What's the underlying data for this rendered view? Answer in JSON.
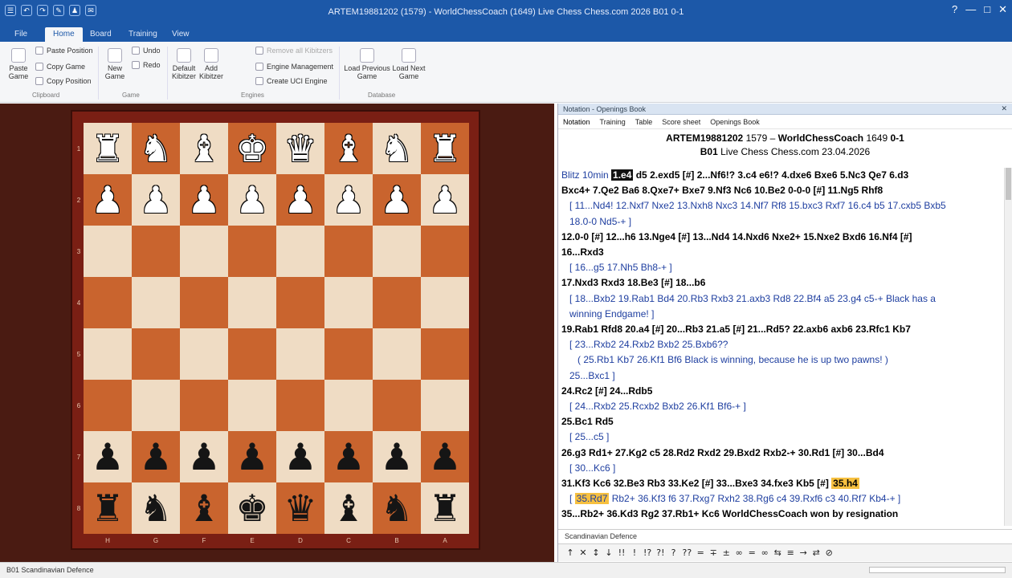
{
  "window": {
    "title": "ARTEM19881202 (1579) - WorldChessCoach (1649)  Live Chess Chess.com 2026  B01 0-1",
    "controls": [
      "?",
      "—",
      "□",
      "✕"
    ]
  },
  "quick_access": [
    "☰",
    "↶",
    "↷",
    "✎",
    "♟",
    "✉"
  ],
  "menu_tabs": [
    "File",
    "Home",
    "Board",
    "Training",
    "View"
  ],
  "ribbon": {
    "paste_game": "Paste Game",
    "paste_position": "Paste Position",
    "copy_game": "Copy Game",
    "copy_position": "Copy Position",
    "new_game": "New Game",
    "undo": "Undo",
    "redo": "Redo",
    "default_kibitzer": "Default Kibitzer",
    "add_kibitzer": "Add Kibitzer",
    "remove_kibitzer": "Remove all Kibitzers",
    "engine_management": "Engine Management",
    "create_uci": "Create UCI Engine",
    "load_previous": "Load Previous Game",
    "load_next": "Load Next Game",
    "groups": [
      "Clipboard",
      "Game",
      "Engines",
      "Database"
    ]
  },
  "board": {
    "ranks": [
      "1",
      "2",
      "3",
      "4",
      "5",
      "6",
      "7",
      "8"
    ],
    "files": [
      "H",
      "G",
      "F",
      "E",
      "D",
      "C",
      "B",
      "A"
    ],
    "rows": [
      [
        "wR",
        "wN",
        "wB",
        "wK",
        "wQ",
        "wB",
        "wN",
        "wR"
      ],
      [
        "wP",
        "wP",
        "wP",
        "wP",
        "wP",
        "wP",
        "wP",
        "wP"
      ],
      [
        "",
        "",
        "",
        "",
        "",
        "",
        "",
        ""
      ],
      [
        "",
        "",
        "",
        "",
        "",
        "",
        "",
        ""
      ],
      [
        "",
        "",
        "",
        "",
        "",
        "",
        "",
        ""
      ],
      [
        "",
        "",
        "",
        "",
        "",
        "",
        "",
        ""
      ],
      [
        "bP",
        "bP",
        "bP",
        "bP",
        "bP",
        "bP",
        "bP",
        "bP"
      ],
      [
        "bR",
        "bN",
        "bB",
        "bK",
        "bQ",
        "bB",
        "bN",
        "bR"
      ]
    ]
  },
  "panel": {
    "title": "Notation - Openings Book",
    "tabs": [
      "Notation",
      "Training",
      "Table",
      "Score sheet",
      "Openings Book"
    ],
    "white": "ARTEM19881202",
    "white_elo": "1579",
    "black": "WorldChessCoach",
    "black_elo": "1649",
    "result": "0-1",
    "eco": "B01",
    "event": "Live Chess Chess.com 23.04.2026",
    "opening_name": "Scandinavian Defence"
  },
  "notation": {
    "l1": {
      "tc": "Blitz 10min ",
      "cur": "1.e4",
      "rest": " d5  2.exd5 [#]  2...Nf6!?  3.c4  e6!?  4.dxe6  Bxe6  5.Nc3  Qe7  6.d3"
    },
    "l2": "Bxc4+  7.Qe2  Ba6  8.Qxe7+  Bxe7  9.Nf3  Nc6  10.Be2  0-0-0 [#]  11.Ng5  Rhf8",
    "l3": "[ 11...Nd4! 12.Nxf7 Nxe2 13.Nxh8 Nxc3 14.Nf7 Rf8 15.bxc3 Rxf7 16.c4 b5 17.cxb5 Bxb5",
    "l4": "18.0-0 Nd5-+ ]",
    "l5": "12.0-0 [#]  12...h6  13.Nge4 [#]  13...Nd4  14.Nxd6  Nxe2+  15.Nxe2  Bxd6  16.Nf4 [#]",
    "l6": "16...Rxd3",
    "l7": "[ 16...g5  17.Nh5  Bh8-+ ]",
    "l8": "17.Nxd3  Rxd3  18.Be3 [#]  18...b6",
    "l9": "[ 18...Bxb2  19.Rab1  Bd4  20.Rb3  Rxb3  21.axb3  Rd8  22.Bf4  a5  23.g4  c5-+  Black has a",
    "l10": "winning Endgame! ]",
    "l11": "19.Rab1  Rfd8  20.a4 [#]  20...Rb3  21.a5 [#]  21...Rd5?  22.axb6  axb6  23.Rfc1  Kb7",
    "l12": "[ 23...Rxb2  24.Rxb2  Bxb2  25.Bxb6??",
    "l13": "( 25.Rb1  Kb7  26.Kf1  Bf6 Black is winning, because he is up two pawns! )",
    "l14": "25...Bxc1 ]",
    "l15": "24.Rc2 [#]  24...Rdb5",
    "l16": "[ 24...Rxb2  25.Rcxb2  Bxb2  26.Kf1  Bf6-+ ]",
    "l17": "25.Bc1  Rd5",
    "l18": "[ 25...c5 ]",
    "l19": "26.g3  Rd1+  27.Kg2  c5  28.Rd2  Rxd2  29.Bxd2  Rxb2-+  30.Rd1 [#]  30...Bd4",
    "l20": "[ 30...Kc6 ]",
    "l21": {
      "a": "31.Kf3  Kc6  32.Be3  Rb3  33.Ke2 [#]  33...Bxe3  34.fxe3  Kb5 [#]  ",
      "b": "35.h4"
    },
    "l22": {
      "a": "35.Rd7",
      "b": "  Rb2+  36.Kf3  f6  37.Rxg7  Rxh2  38.Rg6  c4  39.Rxf6  c3  40.Rf7  Kb4-+ ]"
    },
    "l23": "35...Rb2+  36.Kd3  Rg2  37.Rb1+  Kc6  WorldChessCoach won by resignation"
  },
  "symbols": [
    "↑",
    "✕",
    "↕",
    "↓",
    "!!",
    "!",
    "!?",
    "?!",
    "?",
    "??",
    "=",
    "∓",
    "±",
    "∞",
    "=",
    "∞",
    "⇆",
    "≡",
    "→",
    "⇄",
    "⊘"
  ],
  "status": {
    "opening": "B01 Scandinavian Defence",
    "zoom": "0%"
  }
}
